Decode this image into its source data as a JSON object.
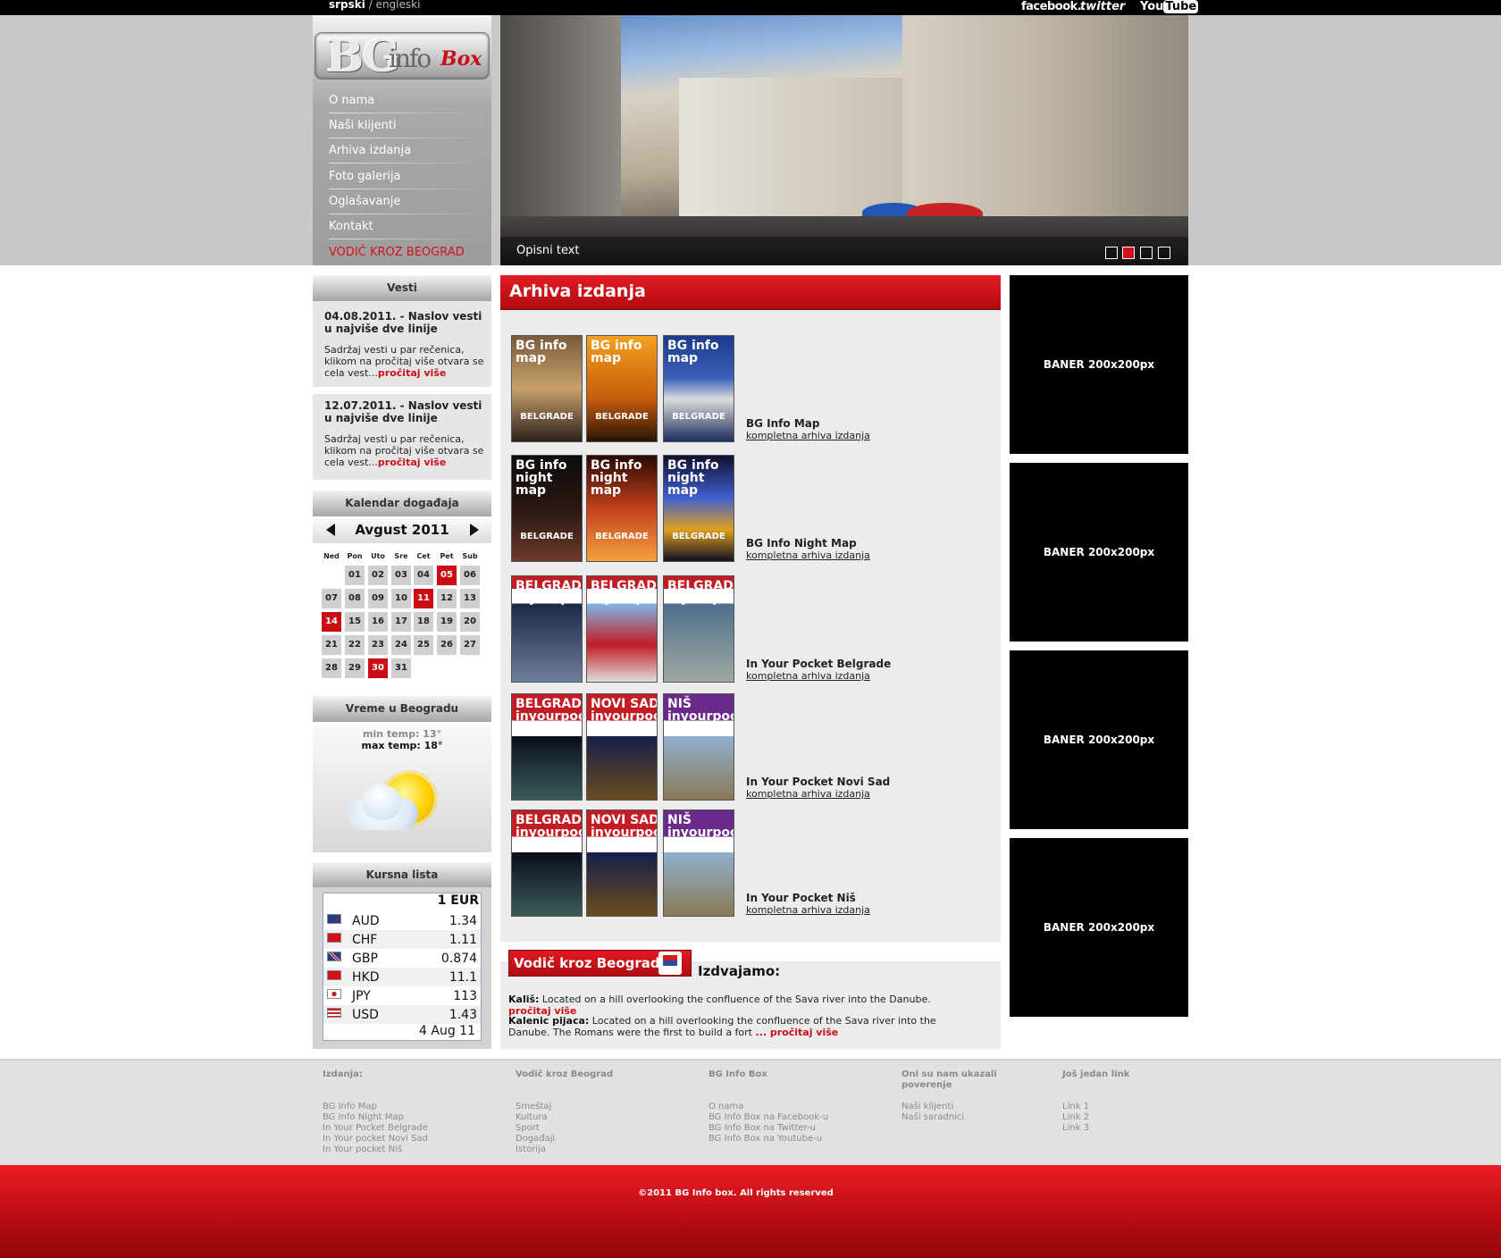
{
  "topbar": {
    "lang_active": "srpski",
    "lang_sep": " / ",
    "lang_other": "engleski",
    "facebook": "facebook.",
    "twitter": "twitter",
    "youtube_you": "You",
    "youtube_tube": "Tube"
  },
  "logo": {
    "bg": "BG",
    "info": "info",
    "box": "Box"
  },
  "nav": {
    "items": [
      "O nama",
      "Naši klijenti",
      "Arhiva izdanja",
      "Foto galerija",
      "Oglašavanje",
      "Kontakt",
      "VODIČ KROZ BEOGRAD"
    ]
  },
  "hero": {
    "caption": "Opisni text",
    "slide_count": 4,
    "active_slide": 2
  },
  "news": {
    "heading": "Vesti",
    "items": [
      {
        "title": "04.08.2011. - Naslov vesti u najviše dve linije",
        "text": "Sadržaj vesti u par rečenica, klikom na pročitaj više otvara se cela vest...",
        "more": "pročitaj više"
      },
      {
        "title": "12.07.2011. - Naslov vesti u najviše dve linije",
        "text": "Sadržaj vesti u par rečenica, klikom na pročitaj više otvara se cela vest...",
        "more": "pročitaj više"
      }
    ]
  },
  "calendar": {
    "heading": "Kalendar događaja",
    "month": "Avgust 2011",
    "daynames": [
      "Ned",
      "Pon",
      "Uto",
      "Sre",
      "Cet",
      "Pet",
      "Sub"
    ],
    "days": [
      "01",
      "02",
      "03",
      "04",
      "05",
      "06",
      "07",
      "08",
      "09",
      "10",
      "11",
      "12",
      "13",
      "14",
      "15",
      "16",
      "17",
      "18",
      "19",
      "20",
      "21",
      "22",
      "23",
      "24",
      "25",
      "26",
      "27",
      "28",
      "29",
      "30",
      "31"
    ],
    "first_weekday": 1,
    "highlighted": [
      "05",
      "11",
      "14",
      "30"
    ]
  },
  "weather": {
    "heading": "Vreme u Beogradu",
    "min": "min temp: 13°",
    "max": "max temp: 18°",
    "icon": "partly-cloudy-icon"
  },
  "currency": {
    "heading": "Kursna lista",
    "base": "1 EUR",
    "rows": [
      {
        "code": "AUD",
        "value": "1.34",
        "flag": "australia-flag-icon"
      },
      {
        "code": "CHF",
        "value": "1.11",
        "flag": "switzerland-flag-icon"
      },
      {
        "code": "GBP",
        "value": "0.874",
        "flag": "uk-flag-icon"
      },
      {
        "code": "HKD",
        "value": "11.1",
        "flag": "hong-kong-flag-icon"
      },
      {
        "code": "JPY",
        "value": "113",
        "flag": "japan-flag-icon"
      },
      {
        "code": "USD",
        "value": "1.43",
        "flag": "usa-flag-icon"
      }
    ],
    "date": "4 Aug 11"
  },
  "archive": {
    "heading": "Arhiva izdanja",
    "link_label": "kompletna arhiva izdanja",
    "publications": [
      {
        "name": "BG Info Map",
        "covers": [
          {
            "brand": "BG info map",
            "sub": "BELGRADE",
            "bg": "linear-gradient(#7b5b3c,#c7a06a 50%,#2c221a)"
          },
          {
            "brand": "BG info map",
            "sub": "BELGRADE",
            "bg": "linear-gradient(#f4a020,#c45c0c 60%,#2b1407)"
          },
          {
            "brand": "BG info map",
            "sub": "BELGRADE",
            "bg": "linear-gradient(#1c3c8c,#3b60b7 40%,#dcdcdc 60%,#1c2c5c)"
          }
        ]
      },
      {
        "name": "BG Info Night Map",
        "covers": [
          {
            "brand": "BG info night map",
            "sub": "BELGRADE",
            "bg": "linear-gradient(#0b0b0b,#2a1712 50%,#6b3b2a)"
          },
          {
            "brand": "BG info night map",
            "sub": "BELGRADE",
            "bg": "linear-gradient(#2a0a04,#c2401c 50%,#f5a040)"
          },
          {
            "brand": "BG info night map",
            "sub": "BELGRADE",
            "bg": "linear-gradient(#101030,#3e60d0 40%,#e0a020 70%,#101020)"
          }
        ]
      },
      {
        "name": "In Your Pocket Belgrade",
        "covers": [
          {
            "brand": "BELGRADE inyourpocket",
            "sub": "",
            "bg": "linear-gradient(#c21c24 0 12%,#fff 12% 26%,#1a2a44 26%,#6f7f99)"
          },
          {
            "brand": "BELGRADE inyourpocket",
            "sub": "",
            "bg": "linear-gradient(#c21c24 0 12%,#fff 12% 26%,#7fb6e6 26%,#c21c24 65%,#ddd)"
          },
          {
            "brand": "BELGRADE inyourpocket",
            "sub": "",
            "bg": "linear-gradient(#c21c24 0 12%,#fff 12% 26%,#4f6f8f 26%,#9fa9a0)"
          }
        ]
      },
      {
        "name": "In Your Pocket Novi Sad",
        "covers": [
          {
            "brand": "BELGRADE inyourpocket",
            "sub": "",
            "bg": "linear-gradient(#c21c24 0 25%,#fff 25% 40%,#0a0e1a 40%,#3b5b5b)"
          },
          {
            "brand": "NOVI SAD inyourpocket",
            "sub": "",
            "bg": "linear-gradient(#c21c24 0 25%,#fff 25% 40%,#16204a 40%,#6b4b20)"
          },
          {
            "brand": "NIŠ inyourpocket",
            "sub": "",
            "bg": "linear-gradient(#6a2a8a 0 25%,#fff 25% 40%,#8fb0cf 40%,#8a7a55)"
          }
        ]
      },
      {
        "name": "In Your Pocket Niš",
        "covers": [
          {
            "brand": "BELGRADE inyourpocket",
            "sub": "",
            "bg": "linear-gradient(#c21c24 0 25%,#fff 25% 40%,#0a0e1a 40%,#3b5b5b)"
          },
          {
            "brand": "NOVI SAD inyourpocket",
            "sub": "",
            "bg": "linear-gradient(#c21c24 0 25%,#fff 25% 40%,#16204a 40%,#6b4b20)"
          },
          {
            "brand": "NIŠ inyourpocket",
            "sub": "",
            "bg": "linear-gradient(#6a2a8a 0 25%,#fff 25% 40%,#8fb0cf 40%,#8a7a55)"
          }
        ]
      }
    ]
  },
  "vodic": {
    "badge": "Vodič kroz Beograd",
    "heading": "Izdvajamo:",
    "items": [
      {
        "name": "Kališ:",
        "text": " Located on a hill overlooking the confluence of the Sava river into the Danube. ",
        "more": "pročitaj više"
      },
      {
        "name": "Kalenic pijaca:",
        "text": " Located on a hill overlooking the confluence of the Sava river into the Danube. The Romans were the first to build a fort ",
        "more": "... pročitaj više"
      }
    ]
  },
  "banners": [
    "BANER 200x200px",
    "BANER 200x200px",
    "BANER 200x200px",
    "BANER 200x200px"
  ],
  "footer": {
    "columns": [
      {
        "heading": "Izdanja:",
        "links": [
          "BG Info Map",
          "BG Info Night Map",
          "In Your Pocket Belgrade",
          "In Your pocket Novi Sad",
          "In Your pocket Niš"
        ]
      },
      {
        "heading": "Vodič kroz Beograd",
        "links": [
          "Smeštaj",
          "Kultura",
          "Sport",
          "Događaji",
          "Istorija"
        ]
      },
      {
        "heading": "BG Info Box",
        "links": [
          "O nama",
          "BG Info Box na Facebook-u",
          "BG Info Box na Twitter-u",
          "BG Info Box na Youtube-u"
        ]
      },
      {
        "heading": "Oni su nam ukazali poverenje",
        "links": [
          "Naši klijenti",
          "Naši saradnici"
        ]
      },
      {
        "heading": "Još jedan link",
        "links": [
          "Link 1",
          "Link 2",
          "Link 3"
        ]
      }
    ],
    "copyright": "©2011 BG Info box. All rights reserved"
  },
  "colors": {
    "accent": "#d4101c",
    "header_gray": "#c8c8c8",
    "panel_gray": "#ececec"
  }
}
